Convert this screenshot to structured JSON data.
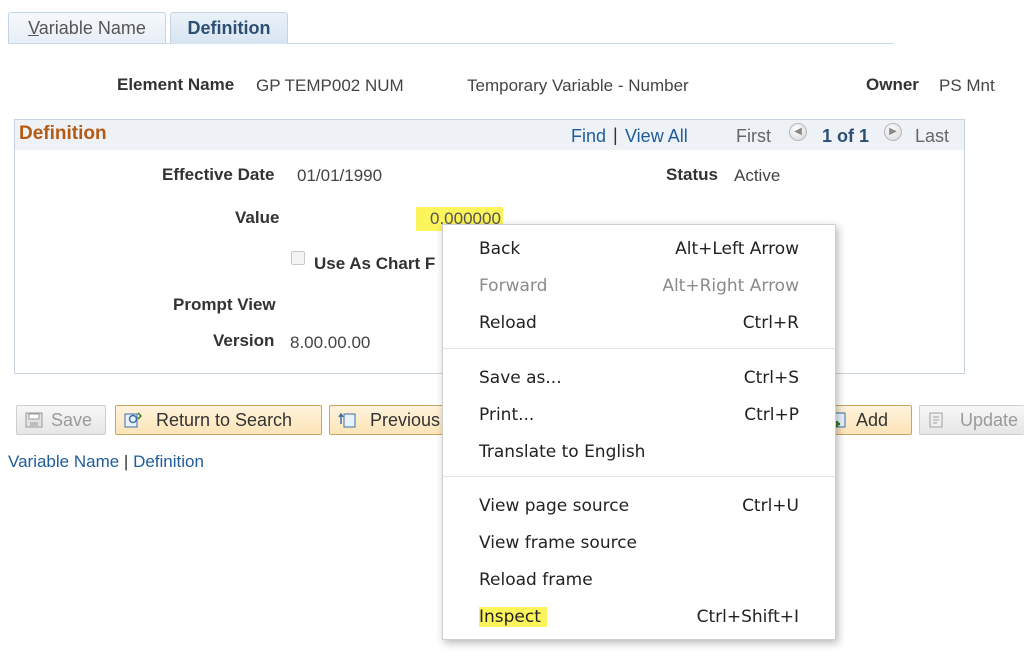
{
  "tabs": {
    "variable_name_u": "V",
    "variable_name_rest": "ariable Name",
    "definition": "Definition"
  },
  "header": {
    "element_name_label": "Element Name",
    "element_name_value": "GP TEMP002 NUM",
    "element_description": "Temporary Variable - Number",
    "owner_label": "Owner",
    "owner_value": "PS Mnt"
  },
  "definition_box": {
    "title": "Definition",
    "find": "Find",
    "divider": "|",
    "view_all": "View All",
    "first": "First",
    "page_count": "1 of 1",
    "last": "Last",
    "effective_date_label": "Effective Date",
    "effective_date_value": "01/01/1990",
    "status_label": "Status",
    "status_value": "Active",
    "value_label": "Value",
    "value_value": "0.000000",
    "use_as_chart_label": "Use As Chart F",
    "prompt_view_label": "Prompt View",
    "version_label": "Version",
    "version_value": "8.00.00.00"
  },
  "toolbar": {
    "save": "Save",
    "return_to_search": "Return to Search",
    "previous": "Previous",
    "add": "Add",
    "update": "Update"
  },
  "bottom_links": {
    "variable_name": "Variable Name",
    "divider": "|",
    "definition": "Definition"
  },
  "context_menu": {
    "back": {
      "label": "Back",
      "shortcut": "Alt+Left Arrow"
    },
    "forward": {
      "label": "Forward",
      "shortcut": "Alt+Right Arrow"
    },
    "reload": {
      "label": "Reload",
      "shortcut": "Ctrl+R"
    },
    "save_as": {
      "label": "Save as...",
      "shortcut": "Ctrl+S"
    },
    "print": {
      "label": "Print...",
      "shortcut": "Ctrl+P"
    },
    "translate": {
      "label": "Translate to English"
    },
    "view_page_source": {
      "label": "View page source",
      "shortcut": "Ctrl+U"
    },
    "view_frame_source": {
      "label": "View frame source"
    },
    "reload_frame": {
      "label": "Reload frame"
    },
    "inspect": {
      "label": "Inspect",
      "shortcut": "Ctrl+Shift+I"
    }
  },
  "colors": {
    "section_title": "#b45a14",
    "link": "#1f5c9c",
    "highlight": "#fbf45a",
    "button_fill": "#fde4b8"
  }
}
